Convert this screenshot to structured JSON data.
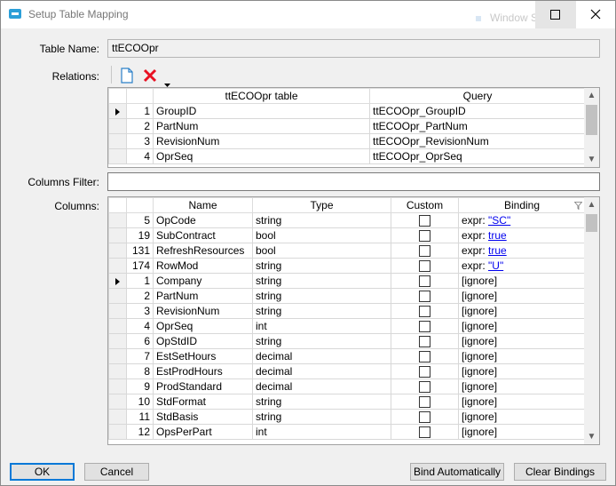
{
  "window": {
    "title": "Setup Table Mapping",
    "background_window_text": "Window S"
  },
  "form": {
    "table_name_label": "Table Name:",
    "table_name_value": "ttECOOpr",
    "relations_label": "Relations:",
    "columns_filter_label": "Columns Filter:",
    "columns_filter_value": "",
    "columns_label": "Columns:"
  },
  "relations": {
    "headers": [
      "ttECOOpr table",
      "Query"
    ],
    "rows": [
      {
        "n": "1",
        "table": "GroupID",
        "query": "ttECOOpr_GroupID",
        "current": true
      },
      {
        "n": "2",
        "table": "PartNum",
        "query": "ttECOOpr_PartNum",
        "current": false
      },
      {
        "n": "3",
        "table": "RevisionNum",
        "query": "ttECOOpr_RevisionNum",
        "current": false
      },
      {
        "n": "4",
        "table": "OprSeq",
        "query": "ttECOOpr_OprSeq",
        "current": false
      }
    ]
  },
  "columns": {
    "headers": [
      "Name",
      "Type",
      "Custom",
      "Binding"
    ],
    "rows": [
      {
        "n": "5",
        "name": "OpCode",
        "type": "string",
        "custom": false,
        "binding_prefix": "expr: ",
        "binding_link": "\"SC\"",
        "current": false
      },
      {
        "n": "19",
        "name": "SubContract",
        "type": "bool",
        "custom": false,
        "binding_prefix": "expr: ",
        "binding_link": "true",
        "current": false
      },
      {
        "n": "131",
        "name": "RefreshResources",
        "type": "bool",
        "custom": false,
        "binding_prefix": "expr: ",
        "binding_link": "true",
        "current": false
      },
      {
        "n": "174",
        "name": "RowMod",
        "type": "string",
        "custom": false,
        "binding_prefix": "expr: ",
        "binding_link": "\"U\"",
        "current": false
      },
      {
        "n": "1",
        "name": "Company",
        "type": "string",
        "custom": false,
        "binding_prefix": "[ignore]",
        "binding_link": "",
        "current": true
      },
      {
        "n": "2",
        "name": "PartNum",
        "type": "string",
        "custom": false,
        "binding_prefix": "[ignore]",
        "binding_link": "",
        "current": false
      },
      {
        "n": "3",
        "name": "RevisionNum",
        "type": "string",
        "custom": false,
        "binding_prefix": "[ignore]",
        "binding_link": "",
        "current": false
      },
      {
        "n": "4",
        "name": "OprSeq",
        "type": "int",
        "custom": false,
        "binding_prefix": "[ignore]",
        "binding_link": "",
        "current": false
      },
      {
        "n": "6",
        "name": "OpStdID",
        "type": "string",
        "custom": false,
        "binding_prefix": "[ignore]",
        "binding_link": "",
        "current": false
      },
      {
        "n": "7",
        "name": "EstSetHours",
        "type": "decimal",
        "custom": false,
        "binding_prefix": "[ignore]",
        "binding_link": "",
        "current": false
      },
      {
        "n": "8",
        "name": "EstProdHours",
        "type": "decimal",
        "custom": false,
        "binding_prefix": "[ignore]",
        "binding_link": "",
        "current": false
      },
      {
        "n": "9",
        "name": "ProdStandard",
        "type": "decimal",
        "custom": false,
        "binding_prefix": "[ignore]",
        "binding_link": "",
        "current": false
      },
      {
        "n": "10",
        "name": "StdFormat",
        "type": "string",
        "custom": false,
        "binding_prefix": "[ignore]",
        "binding_link": "",
        "current": false
      },
      {
        "n": "11",
        "name": "StdBasis",
        "type": "string",
        "custom": false,
        "binding_prefix": "[ignore]",
        "binding_link": "",
        "current": false
      },
      {
        "n": "12",
        "name": "OpsPerPart",
        "type": "int",
        "custom": false,
        "binding_prefix": "[ignore]",
        "binding_link": "",
        "current": false
      }
    ]
  },
  "buttons": {
    "ok": "OK",
    "cancel": "Cancel",
    "bind_automatically": "Bind Automatically",
    "clear_bindings": "Clear Bindings"
  },
  "icons": {
    "new": "new-document-icon",
    "delete": "delete-x-icon",
    "dropdown": "dropdown-arrow-icon",
    "filter": "filter-icon"
  },
  "colors": {
    "accent": "#0078d7",
    "delete_red": "#e81123",
    "link": "#0000ee"
  }
}
